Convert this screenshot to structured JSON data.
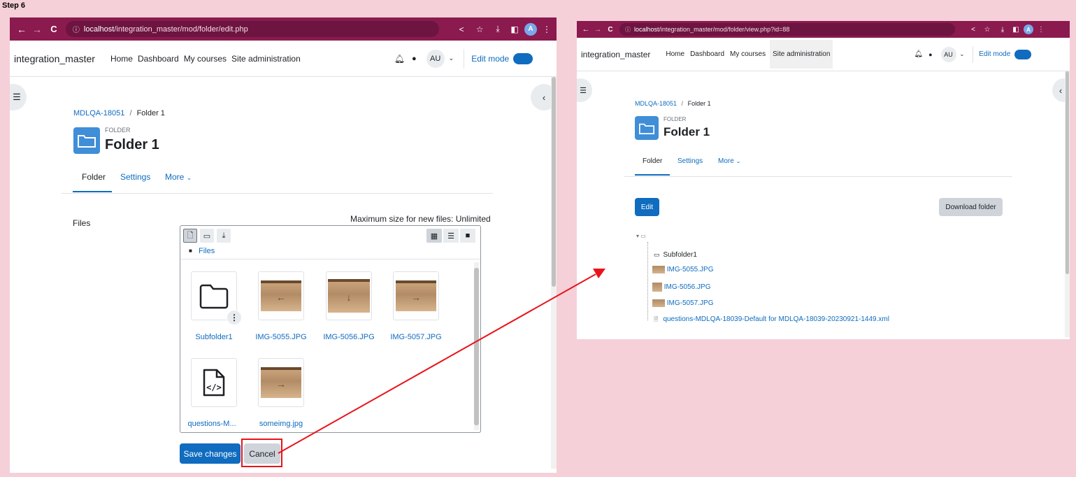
{
  "step_label": "Step 6",
  "left": {
    "url_host": "localhost",
    "url_path": "/integration_master/mod/folder/edit.php",
    "avatar": "A",
    "site_name": "integration_master",
    "nav": [
      "Home",
      "Dashboard",
      "My courses",
      "Site administration"
    ],
    "user": "AU",
    "edit_mode": "Edit mode",
    "breadcrumb": {
      "course": "MDLQA-18051",
      "sep": "/",
      "current": "Folder 1"
    },
    "activity_type": "FOLDER",
    "title": "Folder 1",
    "tabs": [
      "Folder",
      "Settings",
      "More"
    ],
    "files_label": "Files",
    "max_size": "Maximum size for new files: Unlimited",
    "fp_path": "Files",
    "files": [
      {
        "name": "Subfolder1",
        "kind": "folder"
      },
      {
        "name": "IMG-5055.JPG",
        "kind": "image",
        "arrow": "←"
      },
      {
        "name": "IMG-5056.JPG",
        "kind": "image",
        "arrow": "↓"
      },
      {
        "name": "IMG-5057.JPG",
        "kind": "image",
        "arrow": "→"
      },
      {
        "name": "questions-M...",
        "kind": "code"
      },
      {
        "name": "someimg.jpg",
        "kind": "image",
        "arrow": "→"
      }
    ],
    "save_label": "Save changes",
    "cancel_label": "Cancel"
  },
  "right": {
    "url_host": "localhost",
    "url_path": "/integration_master/mod/folder/view.php?id=88",
    "avatar": "A",
    "site_name": "integration_master",
    "nav": [
      "Home",
      "Dashboard",
      "My courses",
      "Site administration"
    ],
    "user": "AU",
    "edit_mode": "Edit mode",
    "breadcrumb": {
      "course": "MDLQA-18051",
      "sep": "/",
      "current": "Folder 1"
    },
    "activity_type": "FOLDER",
    "title": "Folder 1",
    "tabs": [
      "Folder",
      "Settings",
      "More"
    ],
    "edit_label": "Edit",
    "download_label": "Download folder",
    "tree": [
      {
        "name": "Subfolder1",
        "kind": "folder"
      },
      {
        "name": "IMG-5055.JPG",
        "kind": "image"
      },
      {
        "name": "IMG-5056.JPG",
        "kind": "image"
      },
      {
        "name": "IMG-5057.JPG",
        "kind": "image"
      },
      {
        "name": "questions-MDLQA-18039-Default for MDLQA-18039-20230921-1449.xml",
        "kind": "file"
      }
    ]
  },
  "colors": {
    "chrome": "#8b1a4e",
    "primary": "#0f6cbf",
    "annotation": "#e8141b",
    "background": "#f5d0d8"
  }
}
